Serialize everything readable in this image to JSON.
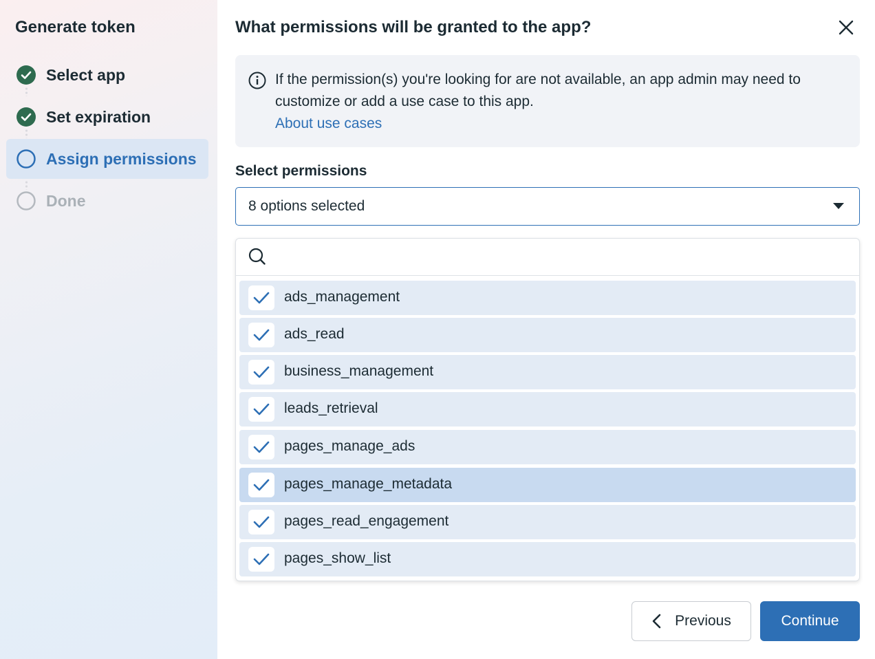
{
  "sidebar": {
    "title": "Generate token",
    "steps": [
      {
        "label": "Select app",
        "state": "complete"
      },
      {
        "label": "Set expiration",
        "state": "complete"
      },
      {
        "label": "Assign permissions",
        "state": "active"
      },
      {
        "label": "Done",
        "state": "pending"
      }
    ]
  },
  "main": {
    "title": "What permissions will be granted to the app?",
    "info": {
      "text": "If the permission(s) you're looking for are not available, an app admin may need to customize or add a use case to this app.",
      "link": "About use cases"
    },
    "permissions": {
      "label": "Select permissions",
      "selected_text": "8 options selected",
      "search_placeholder": "",
      "options": [
        {
          "label": "ads_management",
          "checked": true
        },
        {
          "label": "ads_read",
          "checked": true
        },
        {
          "label": "business_management",
          "checked": true
        },
        {
          "label": "leads_retrieval",
          "checked": true
        },
        {
          "label": "pages_manage_ads",
          "checked": true
        },
        {
          "label": "pages_manage_metadata",
          "checked": true,
          "hovered": true
        },
        {
          "label": "pages_read_engagement",
          "checked": true
        },
        {
          "label": "pages_show_list",
          "checked": true
        }
      ]
    },
    "buttons": {
      "previous": "Previous",
      "continue": "Continue"
    }
  },
  "colors": {
    "accent": "#2d6fb5",
    "complete_green": "#2e6b4f",
    "option_bg": "#e3ebf5",
    "option_hover_bg": "#c8daf0",
    "info_bg": "#f1f3f7"
  },
  "icons": {
    "close": "close-icon",
    "info": "info-icon",
    "search": "search-icon",
    "caret": "caret-down-icon",
    "check": "checkmark-icon",
    "step_complete": "check-circle-icon",
    "step_active": "circle-outline-icon",
    "previous": "chevron-left-icon"
  }
}
